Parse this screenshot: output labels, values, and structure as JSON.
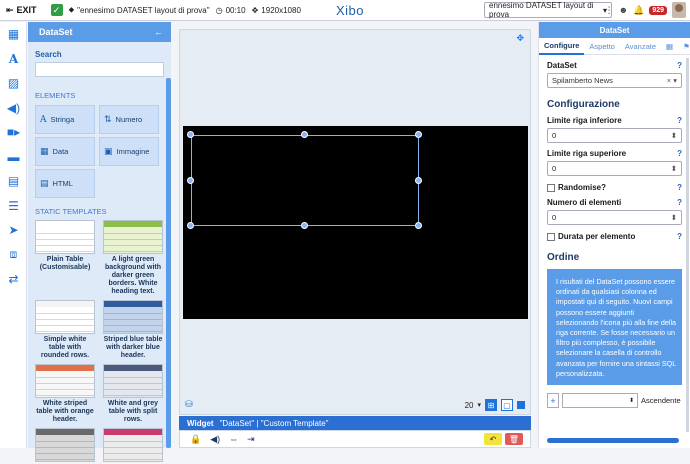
{
  "topbar": {
    "exit_label": "EXIT",
    "check": "✓",
    "layout_name": "\"ennesimo DATASET layout di prova\"",
    "duration": "00:10",
    "resolution": "1920x1080",
    "logo_text": "Xibo",
    "layout_select_value": "ennesimo DATASET layout di prova",
    "notification_count": "929"
  },
  "left_panel": {
    "title": "DataSet",
    "search_label": "Search",
    "elements_label": "ELEMENTS",
    "elements": [
      {
        "label": "Stringa",
        "icon": "A"
      },
      {
        "label": "Numero",
        "icon": "⇅"
      },
      {
        "label": "Data",
        "icon": "▦"
      },
      {
        "label": "Immagine",
        "icon": "▣"
      },
      {
        "label": "HTML",
        "icon": "▤"
      }
    ],
    "static_templates_label": "STATIC TEMPLATES",
    "templates": [
      {
        "label": "Plain Table (Customisable)",
        "head": "#ffffff",
        "body": "#ffffff"
      },
      {
        "label": "A light green background with darker green borders. White heading text.",
        "head": "#8bbf4a",
        "body": "#e9f3d2"
      },
      {
        "label": "Simple white table with rounded rows.",
        "head": "#f4f4f4",
        "body": "#ffffff"
      },
      {
        "label": "Striped blue table with darker blue header.",
        "head": "#2f5c9e",
        "body": "#c4d3ec"
      },
      {
        "label": "White striped table with orange header.",
        "head": "#e0704a",
        "body": "#f7f7f7"
      },
      {
        "label": "White and grey table with split rows.",
        "head": "#4a5a7a",
        "body": "#e4e8ee"
      },
      {
        "label": "",
        "head": "#6a6a6a",
        "body": "#d8d8d8"
      },
      {
        "label": "",
        "head": "#c93a6e",
        "body": "#ececec"
      }
    ]
  },
  "canvas": {
    "zoom": "20"
  },
  "widget_bar": {
    "label": "Widget",
    "name": "\"DataSet\" | \"Custom Template\""
  },
  "right_panel": {
    "title": "DataSet",
    "tabs": [
      "Configure",
      "Aspetto",
      "Avanzate"
    ],
    "dataset_label": "DataSet",
    "dataset_value": "Spilamberto News",
    "configurazione_heading": "Configurazione",
    "fields": [
      {
        "label": "Limite riga inferiore",
        "value": "0"
      },
      {
        "label": "Limite riga superiore",
        "value": "0"
      }
    ],
    "randomise_label": "Randomise?",
    "num_items_label": "Numero di elementi",
    "num_items_value": "0",
    "duration_per_item_label": "Durata per elemento",
    "ordine_heading": "Ordine",
    "ordine_info": "I risultati del DataSet possono essere ordinati da qualsiasi colonna ed impostati qui di seguito. Nuovi campi possono essere aggiunti selezionando l'icona più alla fine della riga corrente. Se fosse necessario un filtro più complesso, è possibile selezionare la casella di controllo avanzata per fornire una sintassi SQL personalizzata.",
    "order_direction": "Ascendente"
  },
  "colors": {
    "accent": "#1e73d8",
    "panel_head": "#5b9ce8",
    "widget_bar": "#2a6fd1"
  }
}
